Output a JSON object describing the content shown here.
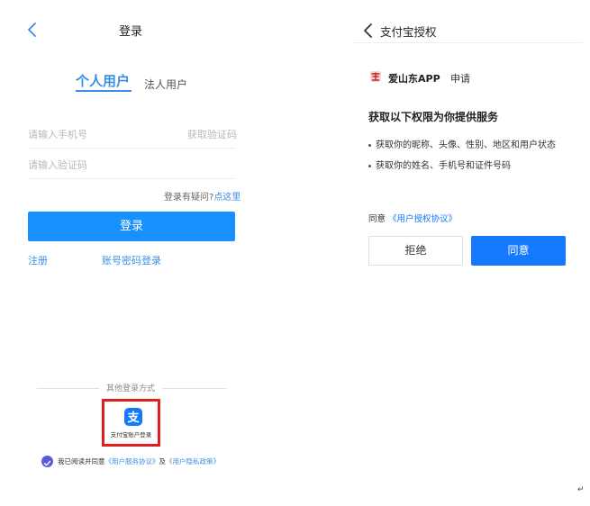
{
  "login_screen": {
    "header": {
      "title": "登录"
    },
    "tabs": {
      "personal": "个人用户",
      "legal": "法人用户"
    },
    "phone_field": {
      "placeholder": "请输入手机号",
      "get_code_label": "获取验证码"
    },
    "code_field": {
      "placeholder": "请输入验证码"
    },
    "help": {
      "question": "登录有疑问?",
      "link": "点这里"
    },
    "login_button": "登录",
    "register_link": "注册",
    "password_login_link": "账号密码登录",
    "other_methods": {
      "label": "其他登录方式",
      "alipay_label": "支付宝账户登录",
      "alipay_logo_glyph": "支"
    },
    "agreement": {
      "prefix": "我已阅读并同意",
      "service_link": "《用户服务协议》",
      "and": "及",
      "privacy_link": "《用户隐私政策》"
    }
  },
  "auth_screen": {
    "header": {
      "title": "支付宝授权"
    },
    "app": {
      "name": "爱山东APP",
      "action": "申请"
    },
    "permissions_heading": "获取以下权限为你提供服务",
    "permissions": [
      "获取你的昵称、头像、性别、地区和用户状态",
      "获取你的姓名、手机号和证件号码"
    ],
    "agree": {
      "prefix": "同意",
      "link": "《用户授权协议》"
    },
    "reject_button": "拒绝",
    "consent_button": "同意"
  },
  "page_mark": "↵",
  "colors": {
    "accent_blue": "#1890ff",
    "alipay_blue": "#1677ff",
    "highlight_red": "#e01f1f",
    "check_purple": "#5b5bd6"
  },
  "icons": [
    "back-chevron-icon",
    "alipay-logo-icon",
    "app-logo-icon",
    "checked-circle-icon"
  ]
}
